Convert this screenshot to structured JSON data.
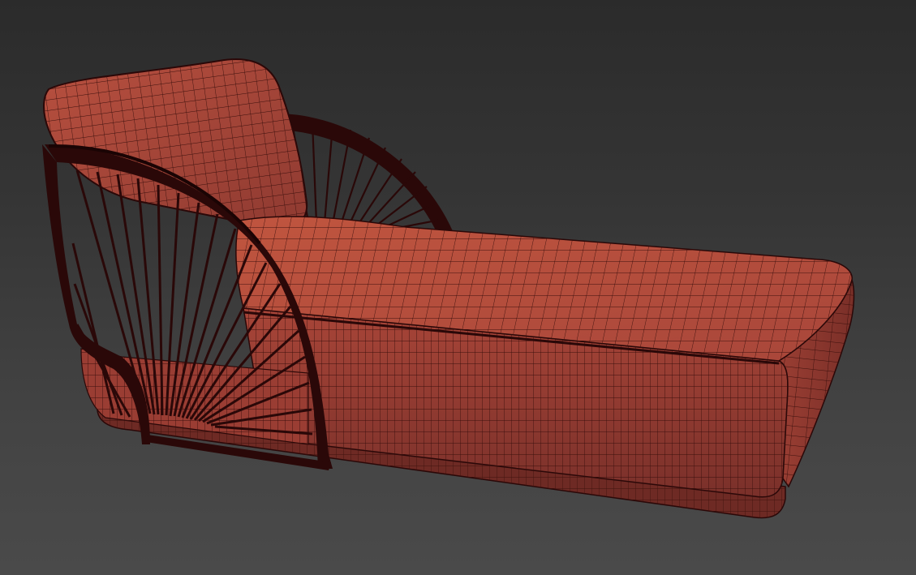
{
  "viewport": {
    "background_top": "#2b2b2b",
    "background_bottom": "#4a4a4a"
  },
  "model": {
    "object": "chaise-lounge",
    "render_mode": "wireframe-on-shaded",
    "surface_color": "#b04a3e",
    "surface_shadow_color": "#6e2a24",
    "wire_color": "#3a0f0c",
    "frame_color": "#2a0808",
    "parts": [
      "back-cushion",
      "seat-cushion",
      "front-arm-frame",
      "rear-arm-frame",
      "cord-weave",
      "base-plinth"
    ]
  }
}
